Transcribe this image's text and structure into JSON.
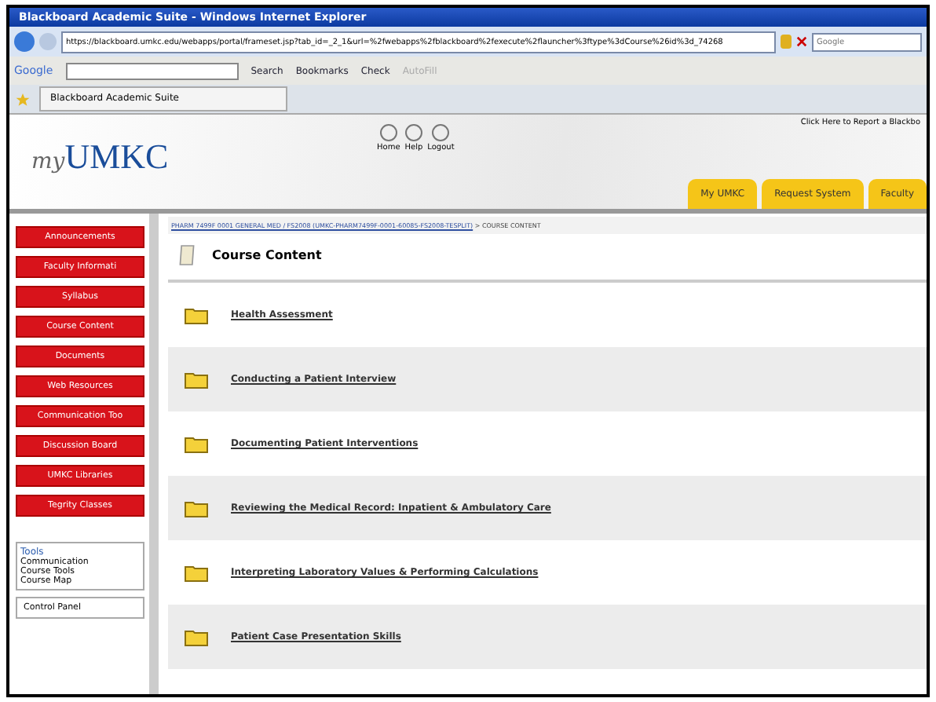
{
  "window": {
    "title": "Blackboard Academic Suite - Windows Internet Explorer"
  },
  "address_bar": {
    "url": "https://blackboard.umkc.edu/webapps/portal/frameset.jsp?tab_id=_2_1&url=%2fwebapps%2fblackboard%2fexecute%2flauncher%3ftype%3dCourse%26id%3d_74268",
    "search_placeholder": "Google"
  },
  "google_toolbar": {
    "logo": "Google",
    "items": [
      {
        "label": "Search",
        "disabled": false
      },
      {
        "label": "Bookmarks",
        "disabled": false
      },
      {
        "label": "Check",
        "disabled": false
      },
      {
        "label": "AutoFill",
        "disabled": true
      }
    ]
  },
  "browser_tab": {
    "title": "Blackboard Academic Suite"
  },
  "header": {
    "logo_prefix": "my",
    "logo": "UMKC",
    "links": [
      "Home",
      "Help",
      "Logout"
    ],
    "report_link": "Click Here to Report a Blackbo",
    "tabs": [
      {
        "label": "My UMKC",
        "selected": false
      },
      {
        "label": "Request System",
        "selected": false
      },
      {
        "label": "Faculty",
        "selected": false
      }
    ]
  },
  "course_menu": [
    "Announcements",
    "Faculty Informati",
    "Syllabus",
    "Course Content",
    "Documents",
    "Web Resources",
    "Communication Too",
    "Discussion Board",
    "UMKC Libraries",
    "Tegrity Classes"
  ],
  "tools": {
    "title": "Tools",
    "items": [
      "Communication",
      "Course Tools",
      "Course Map"
    ]
  },
  "control_panel": "Control Panel",
  "breadcrumb": {
    "course": "PHARM 7499F 0001 GENERAL MED / FS2008 (UMKC-PHARM7499F-0001-60085-FS2008-TESPLIT)",
    "current": " > COURSE CONTENT"
  },
  "page_title": "Course Content",
  "folders": [
    "Health Assessment",
    "Conducting a Patient Interview",
    "Documenting Patient Interventions",
    "Reviewing the Medical Record: Inpatient & Ambulatory Care",
    "Interpreting Laboratory Values & Performing Calculations",
    "Patient Case Presentation Skills"
  ]
}
